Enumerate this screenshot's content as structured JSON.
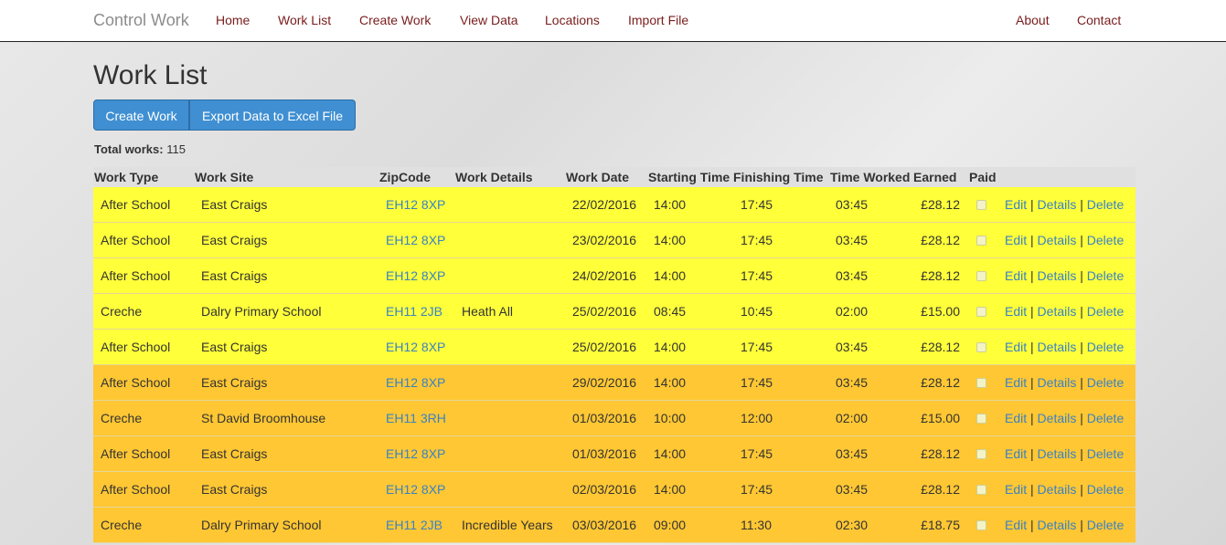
{
  "nav": {
    "brand": "Control Work",
    "links": [
      "Home",
      "Work List",
      "Create Work",
      "View Data",
      "Locations",
      "Import File"
    ],
    "right_links": [
      "About",
      "Contact"
    ]
  },
  "page": {
    "title": "Work List",
    "create_button": "Create Work",
    "export_button": "Export Data to Excel File",
    "total_label": "Total works:",
    "total_value": "115"
  },
  "table": {
    "headers": [
      "Work Type",
      "Work Site",
      "ZipCode",
      "Work Details",
      "Work Date",
      "Starting Time",
      "Finishing Time",
      "Time Worked",
      "Earned",
      "Paid"
    ],
    "actions": {
      "edit": "Edit",
      "details": "Details",
      "delete": "Delete",
      "sep": "|"
    },
    "rows": [
      {
        "type": "After School",
        "site": "East Craigs",
        "zip": "EH12 8XP",
        "details": "",
        "date": "22/02/2016",
        "start": "14:00",
        "finish": "17:45",
        "worked": "03:45",
        "earned": "£28.12",
        "color": "yellow"
      },
      {
        "type": "After School",
        "site": "East Craigs",
        "zip": "EH12 8XP",
        "details": "",
        "date": "23/02/2016",
        "start": "14:00",
        "finish": "17:45",
        "worked": "03:45",
        "earned": "£28.12",
        "color": "yellow"
      },
      {
        "type": "After School",
        "site": "East Craigs",
        "zip": "EH12 8XP",
        "details": "",
        "date": "24/02/2016",
        "start": "14:00",
        "finish": "17:45",
        "worked": "03:45",
        "earned": "£28.12",
        "color": "yellow"
      },
      {
        "type": "Creche",
        "site": "Dalry Primary School",
        "zip": "EH11 2JB",
        "details": "Heath All",
        "date": "25/02/2016",
        "start": "08:45",
        "finish": "10:45",
        "worked": "02:00",
        "earned": "£15.00",
        "color": "yellow"
      },
      {
        "type": "After School",
        "site": "East Craigs",
        "zip": "EH12 8XP",
        "details": "",
        "date": "25/02/2016",
        "start": "14:00",
        "finish": "17:45",
        "worked": "03:45",
        "earned": "£28.12",
        "color": "yellow"
      },
      {
        "type": "After School",
        "site": "East Craigs",
        "zip": "EH12 8XP",
        "details": "",
        "date": "29/02/2016",
        "start": "14:00",
        "finish": "17:45",
        "worked": "03:45",
        "earned": "£28.12",
        "color": "orange"
      },
      {
        "type": "Creche",
        "site": "St David Broomhouse",
        "zip": "EH11 3RH",
        "details": "",
        "date": "01/03/2016",
        "start": "10:00",
        "finish": "12:00",
        "worked": "02:00",
        "earned": "£15.00",
        "color": "orange"
      },
      {
        "type": "After School",
        "site": "East Craigs",
        "zip": "EH12 8XP",
        "details": "",
        "date": "01/03/2016",
        "start": "14:00",
        "finish": "17:45",
        "worked": "03:45",
        "earned": "£28.12",
        "color": "orange"
      },
      {
        "type": "After School",
        "site": "East Craigs",
        "zip": "EH12 8XP",
        "details": "",
        "date": "02/03/2016",
        "start": "14:00",
        "finish": "17:45",
        "worked": "03:45",
        "earned": "£28.12",
        "color": "orange"
      },
      {
        "type": "Creche",
        "site": "Dalry Primary School",
        "zip": "EH11 2JB",
        "details": "Incredible Years",
        "date": "03/03/2016",
        "start": "09:00",
        "finish": "11:30",
        "worked": "02:30",
        "earned": "£18.75",
        "color": "orange"
      }
    ]
  }
}
